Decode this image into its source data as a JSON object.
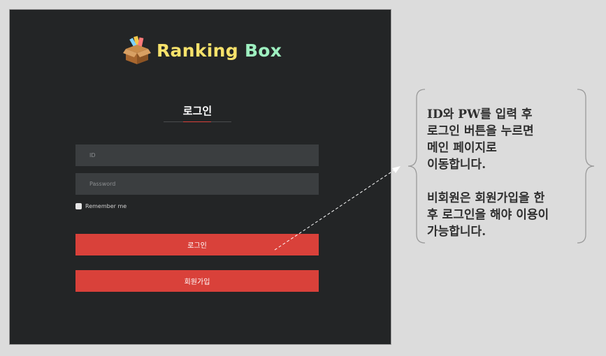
{
  "logo": {
    "word1": "Ranking",
    "word2": "Box"
  },
  "form": {
    "title": "로그인",
    "id_placeholder": "ID",
    "password_placeholder": "Password",
    "remember_label": "Remember me",
    "login_button": "로그인",
    "signup_button": "회원가입"
  },
  "annotation": {
    "line1": "ID와 PW를 입력 후",
    "line2": "로그인 버튼을 누르면",
    "line3": "메인 페이지로",
    "line4": "이동합니다.",
    "line5": "비회원은 회원가입을 한",
    "line6": "후 로그인을 해야 이용이",
    "line7": "가능합니다."
  },
  "colors": {
    "panel_bg": "#232526",
    "accent_red": "#d9413a",
    "logo_yellow": "#f7e26b",
    "logo_mint": "#9ef0c0"
  },
  "icons": {
    "logo_icon": "gift-box-icon",
    "checkbox": "checkbox-icon"
  }
}
